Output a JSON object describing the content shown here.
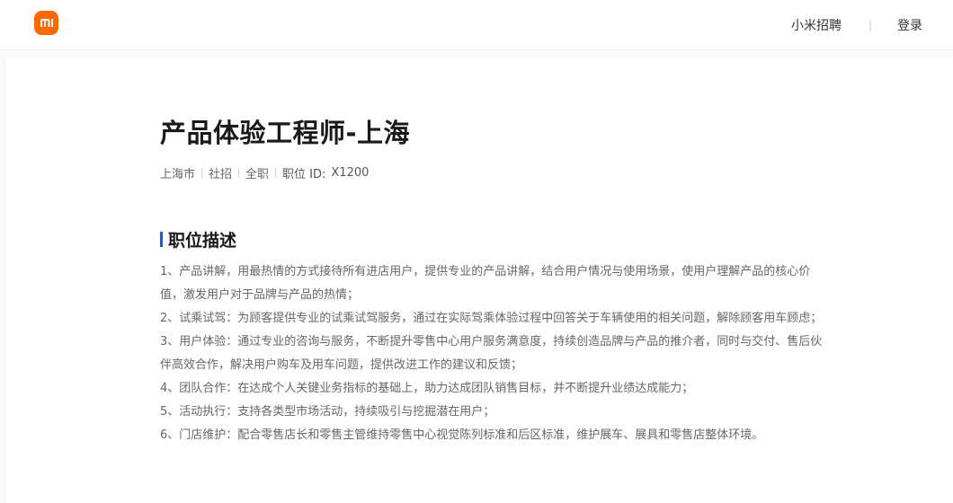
{
  "header": {
    "logo_text": "mi",
    "brand_color": "#ff6900",
    "nav": [
      {
        "label": "小米招聘"
      },
      {
        "label": "登录"
      }
    ],
    "separator": "|"
  },
  "job": {
    "title": "产品体验工程师-上海",
    "meta": [
      "上海市",
      "社招",
      "全职"
    ],
    "id_label": "职位 ID:",
    "id_value": "X1200"
  },
  "description": {
    "title": "职位描述",
    "accent_color": "#2b5aa8",
    "items": [
      "1、产品讲解，用最热情的方式接待所有进店用户，提供专业的产品讲解，结合用户情况与使用场景，使用户理解产品的核心价值，激发用户对于品牌与产品的热情；",
      "2、试乘试驾：为顾客提供专业的试乘试驾服务，通过在实际驾乘体验过程中回答关于车辆使用的相关问题，解除顾客用车顾虑；",
      "3、用户体验：通过专业的咨询与服务，不断提升零售中心用户服务满意度，持续创造品牌与产品的推介者，同时与交付、售后伙伴高效合作，解决用户购车及用车问题，提供改进工作的建议和反馈；",
      "4、团队合作：在达成个人关键业务指标的基础上，助力达成团队销售目标，并不断提升业绩达成能力；",
      "5、活动执行：支持各类型市场活动，持续吸引与挖掘潜在用户；",
      "6、门店维护：配合零售店长和零售主管维持零售中心视觉陈列标准和后区标准，维护展车、展具和零售店整体环境。"
    ]
  }
}
